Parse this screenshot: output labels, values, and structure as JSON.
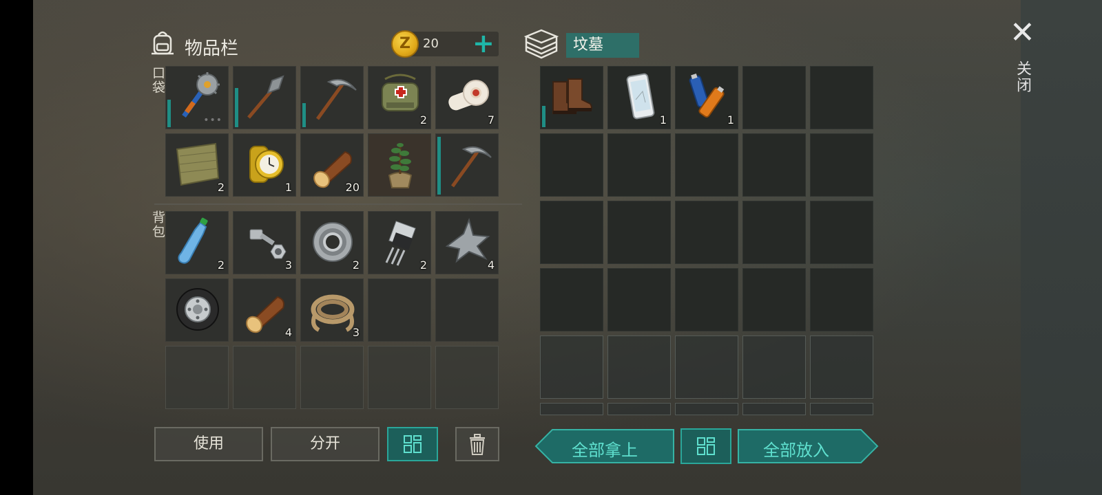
{
  "inventory": {
    "title": "物品栏",
    "currency": "20",
    "pockets_label": "口袋",
    "backpack_label": "背包",
    "pockets": [
      {
        "item": "saw-mace",
        "qty": "",
        "dur": 0.45,
        "dots": true
      },
      {
        "item": "shovel",
        "qty": "",
        "dur": 0.65
      },
      {
        "item": "pickaxe",
        "qty": "",
        "dur": 0.4
      },
      {
        "item": "first-aid-bag",
        "qty": "2"
      },
      {
        "item": "bandage",
        "qty": "7"
      },
      {
        "item": "burlap-cloth",
        "qty": "2"
      },
      {
        "item": "gold-watch",
        "qty": "1"
      },
      {
        "item": "log",
        "qty": "20"
      },
      {
        "item": "potted-sapling",
        "qty": ""
      },
      {
        "item": "pickaxe",
        "qty": "",
        "dur": 0.95
      }
    ],
    "backpack": [
      {
        "item": "water-bottle",
        "qty": "2"
      },
      {
        "item": "bolt-nut",
        "qty": "3"
      },
      {
        "item": "bearing",
        "qty": "2"
      },
      {
        "item": "transistor",
        "qty": "2"
      },
      {
        "item": "scrap-metal",
        "qty": "4"
      },
      {
        "item": "wheel",
        "qty": ""
      },
      {
        "item": "log",
        "qty": "4"
      },
      {
        "item": "rope",
        "qty": "3"
      }
    ],
    "buttons": {
      "use": "使用",
      "split": "分开"
    }
  },
  "container": {
    "name": "坟墓",
    "items": [
      {
        "item": "boots",
        "qty": "",
        "dur": 0.35
      },
      {
        "item": "smartphone",
        "qty": "1"
      },
      {
        "item": "batteries",
        "qty": "1"
      }
    ],
    "take_all": "全部拿上",
    "put_all": "全部放入"
  },
  "close_label": "关闭",
  "colors": {
    "accent": "#2aa79a",
    "teal_fill": "#1c5f5a",
    "coin": "#e2aa1a"
  }
}
